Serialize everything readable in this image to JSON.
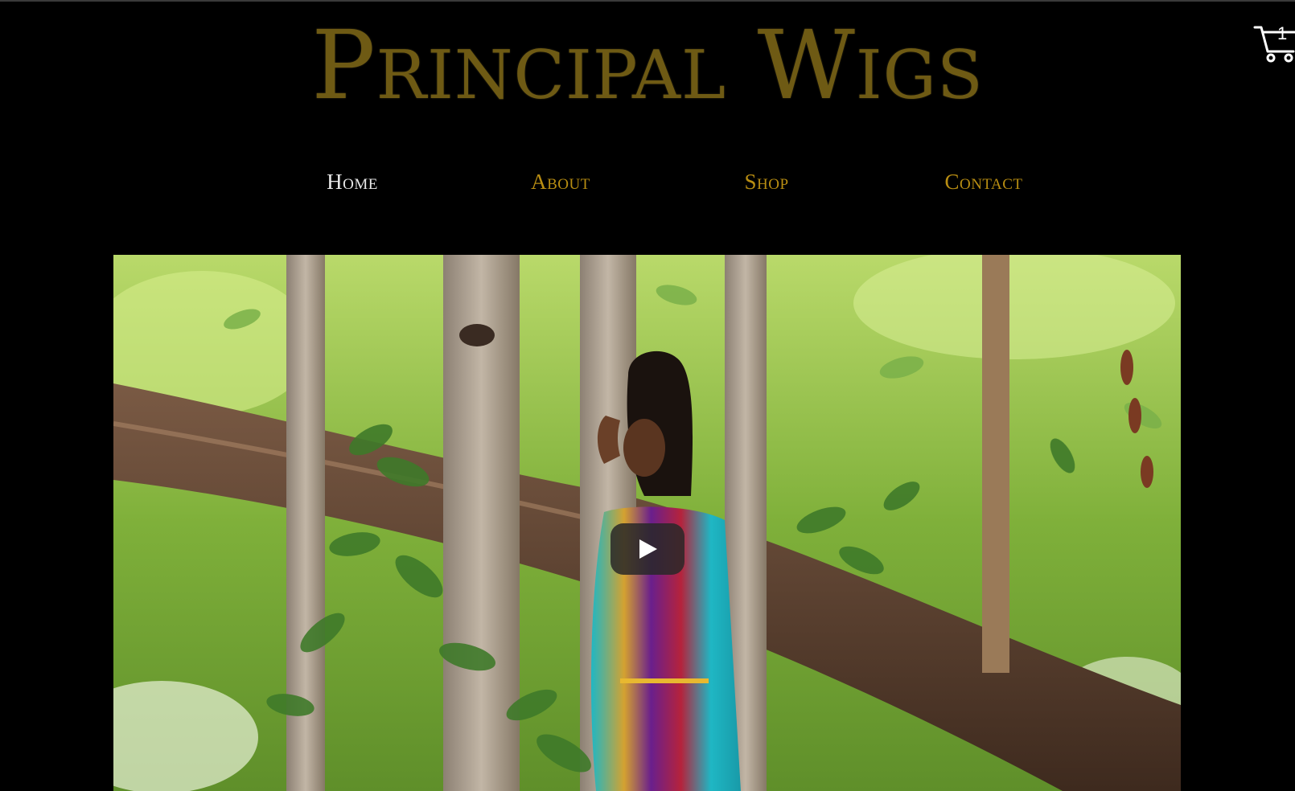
{
  "site": {
    "title": "Principal Wigs"
  },
  "cart": {
    "count": "1",
    "icon": "shopping-cart-icon"
  },
  "nav": {
    "items": [
      {
        "label": "Home",
        "active": true
      },
      {
        "label": "About",
        "active": false
      },
      {
        "label": "Shop",
        "active": false
      },
      {
        "label": "Contact",
        "active": false
      }
    ]
  },
  "video": {
    "play_icon": "play-icon"
  },
  "colors": {
    "background": "#000000",
    "title_gold": "#6e5a14",
    "nav_gold": "#b88d12",
    "nav_active": "#e8e8e8"
  }
}
